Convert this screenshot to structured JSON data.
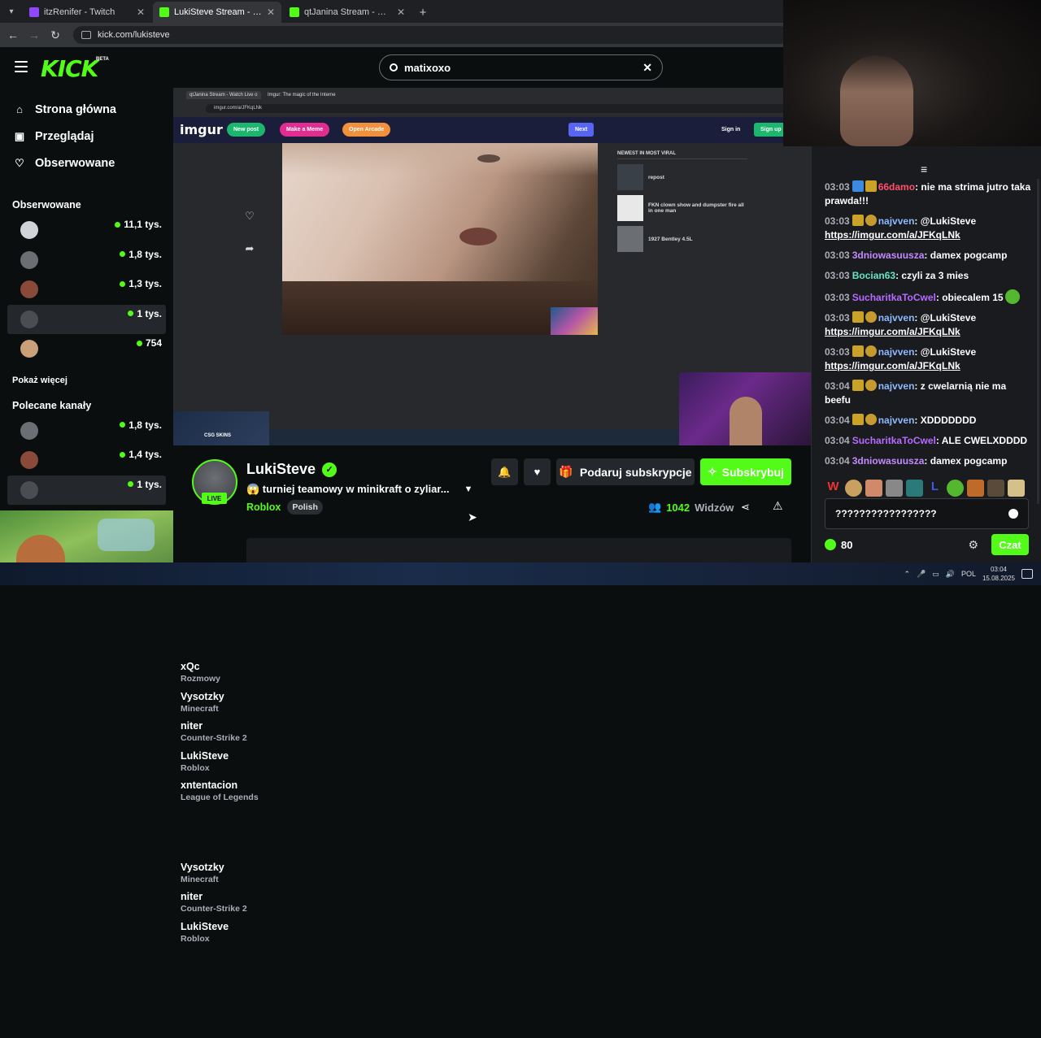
{
  "browser": {
    "tabs": [
      {
        "title": "itzRenifer - Twitch",
        "kind": "twitch",
        "active": false
      },
      {
        "title": "LukiSteve Stream - Watch Live o",
        "kind": "kick",
        "active": true
      },
      {
        "title": "qtJanina Stream - Watch Live o",
        "kind": "kick",
        "active": false
      }
    ],
    "url": "kick.com/lukisteve"
  },
  "header": {
    "logo": "KICK",
    "beta": "BETA",
    "search_value": "matixoxo"
  },
  "sidebar": {
    "nav": [
      {
        "label": "Strona główna",
        "icon": "home-icon"
      },
      {
        "label": "Przeglądaj",
        "icon": "browse-icon"
      },
      {
        "label": "Obserwowane",
        "icon": "heart-icon"
      }
    ],
    "followed_heading": "Obserwowane",
    "followed": [
      {
        "name": "xQc",
        "category": "Rozmowy",
        "viewers": "11,1 tys."
      },
      {
        "name": "Vysotzky",
        "category": "Minecraft",
        "viewers": "1,8 tys."
      },
      {
        "name": "niter",
        "category": "Counter-Strike 2",
        "viewers": "1,3 tys."
      },
      {
        "name": "LukiSteve",
        "category": "Roblox",
        "viewers": "1 tys."
      },
      {
        "name": "xntentacion",
        "category": "League of Legends",
        "viewers": "754"
      }
    ],
    "show_more": "Pokaż więcej",
    "recommended_heading": "Polecane kanały",
    "recommended": [
      {
        "name": "Vysotzky",
        "category": "Minecraft",
        "viewers": "1,8 tys."
      },
      {
        "name": "niter",
        "category": "Counter-Strike 2",
        "viewers": "1,4 tys."
      },
      {
        "name": "LukiSteve",
        "category": "Roblox",
        "viewers": "1 tys."
      }
    ]
  },
  "video": {
    "inner_tab1": "qtJanina Stream - Watch Live o",
    "inner_tab2": "Imgur: The magic of the Interne",
    "inner_url": "imgur.com/a/JFKqLNk",
    "imgur_logo": "imgur",
    "imgur_buttons": [
      "New post",
      "Make a Meme",
      "Open Arcade"
    ],
    "next": "Next",
    "sign_in": "Sign in",
    "sign_up": "Sign up",
    "viral_heading": "NEWEST IN MOST VIRAL",
    "viral": [
      "repost",
      "FKN clown show and dumpster fire all in one man",
      "1927 Bentley 4.5L"
    ],
    "csgo": "CSG SKINS"
  },
  "chat": {
    "messages": [
      {
        "time": "03:03",
        "badges": [
          "blue",
          "crown"
        ],
        "user": "66damo",
        "color": "#ff4f6a",
        "text": "nie ma strima jutro taka prawda!!!"
      },
      {
        "time": "03:03",
        "badges": [
          "crown",
          "gold"
        ],
        "user": "najvven",
        "color": "#8fb8ff",
        "text": "@LukiSteve",
        "link": "https://imgur.com/a/JFKqLNk"
      },
      {
        "time": "03:03",
        "badges": [],
        "user": "3dniowasuusza",
        "color": "#c48bff",
        "text": "damex pogcamp"
      },
      {
        "time": "03:03",
        "badges": [],
        "user": "Bocian63",
        "color": "#63e6c8",
        "text": "czyli za 3 mies"
      },
      {
        "time": "03:03",
        "badges": [],
        "user": "SucharitkaToCwel",
        "color": "#b86bff",
        "text": "obiecalem 15",
        "emote": true
      },
      {
        "time": "03:03",
        "badges": [
          "crown",
          "gold"
        ],
        "user": "najvven",
        "color": "#8fb8ff",
        "text": "@LukiSteve",
        "link": "https://imgur.com/a/JFKqLNk"
      },
      {
        "time": "03:03",
        "badges": [
          "crown",
          "gold"
        ],
        "user": "najvven",
        "color": "#8fb8ff",
        "text": "@LukiSteve",
        "link": "https://imgur.com/a/JFKqLNk"
      },
      {
        "time": "03:04",
        "badges": [
          "crown",
          "gold"
        ],
        "user": "najvven",
        "color": "#8fb8ff",
        "text": "z cwelarnią nie ma beefu"
      },
      {
        "time": "03:04",
        "badges": [
          "crown",
          "gold"
        ],
        "user": "najvven",
        "color": "#8fb8ff",
        "text": "XDDDDDDD"
      },
      {
        "time": "03:04",
        "badges": [],
        "user": "SucharitkaToCwel",
        "color": "#b86bff",
        "text": "ALE CWELXDDDD"
      },
      {
        "time": "03:04",
        "badges": [],
        "user": "3dniowasuusza",
        "color": "#c48bff",
        "text": "damex pogcamp"
      }
    ],
    "input_value": "?????????????????",
    "points": "80",
    "send_label": "Czat"
  },
  "stream": {
    "name": "LukiSteve",
    "live": "LIVE",
    "title": "😱 turniej teamowy w minikraft o zyliar...",
    "category": "Roblox",
    "language": "Polish",
    "gift_label": "Podaruj subskrypcje",
    "subscribe_label": "Subskrybuj",
    "viewers_count": "1042",
    "viewers_label": "Widzów"
  },
  "system": {
    "lang": "POL",
    "time": "03:04",
    "date": "15.08.2025"
  },
  "colors": {
    "kick_green": "#53fc18",
    "bg": "#0b0e0f",
    "chat_bg": "#191b1f"
  }
}
